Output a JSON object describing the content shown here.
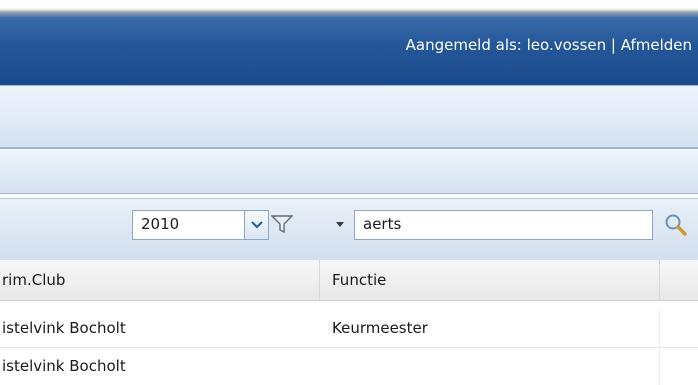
{
  "topbar": {
    "login_prefix": "Aangemeld als: leo.vossen | ",
    "logout_label": "Afmelden"
  },
  "toolbar": {
    "year_value": "2010",
    "search_value": "aerts",
    "icons": [
      "chevron-down-icon",
      "filter-icon",
      "caret-down-icon",
      "search-icon"
    ]
  },
  "grid": {
    "columns": [
      "rim.Club",
      "Functie"
    ],
    "rows": [
      [
        "istelvink Bocholt",
        "Keurmeester"
      ],
      [
        "istelvink Bocholt",
        ""
      ]
    ]
  },
  "colors": {
    "header_blue": "#1e4f91",
    "band_light": "#dde8f5"
  }
}
